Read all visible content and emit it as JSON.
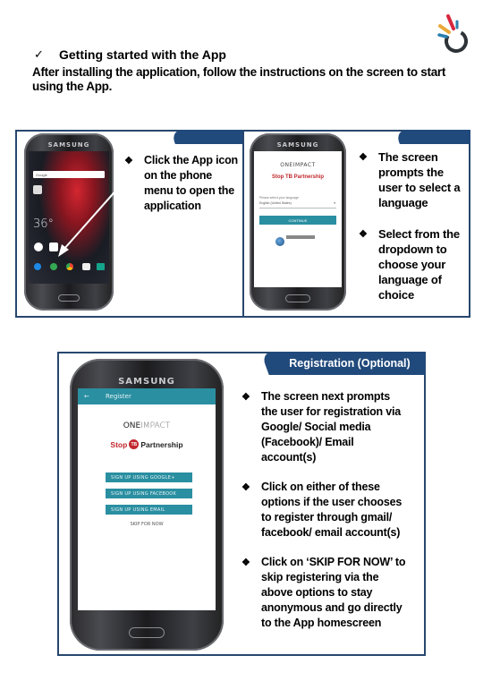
{
  "logo": {
    "icon": "oneimpact-burst-logo",
    "colors": {
      "red": "#d7263d",
      "yellow": "#e9a93a",
      "blue": "#2b7fb0",
      "ring": "#2e3338"
    }
  },
  "heading": {
    "check_icon": "✓",
    "title": "Getting started with the App"
  },
  "intro": "After installing the application, follow the instructions on the screen to start using the App.",
  "frames": {
    "border_color": "#27476e",
    "tab_color": "#214a7c",
    "step1": {
      "bullets": [
        "Click the App icon on the phone menu to open the application"
      ],
      "phone": {
        "brand": "SAMSUNG",
        "search_label": "Google",
        "clock": "36°"
      }
    },
    "step2": {
      "bullets": [
        "The screen prompts the user to select a language",
        "Select from the dropdown to choose your language of choice"
      ],
      "phone": {
        "brand": "SAMSUNG",
        "app_name": "ONEIMPACT",
        "partner": "Stop TB Partnership",
        "select_label": "Please select your language",
        "select_value": "English (United States)",
        "continue_label": "CONTINUE"
      }
    },
    "step3": {
      "tab_label": "Registration (Optional)",
      "bullets": [
        "The screen next prompts the user for registration via Google/ Social media (Facebook)/ Email account(s)",
        "Click on either of these options if the user chooses to register through gmail/ facebook/ email account(s)",
        "Click on ‘SKIP FOR NOW’ to skip registering via the above options to stay anonymous and go directly to the App homescreen"
      ],
      "phone": {
        "brand": "SAMSUNG",
        "header_title": "Register",
        "back_icon": "←",
        "app_name_one": "ONE",
        "app_name_impact": "IMPACT",
        "partner_stop": "Stop",
        "partner_tb": "TB",
        "partner_name": "Partnership",
        "buttons": [
          "SIGN UP USING GOOGLE+",
          "SIGN UP USING FACEBOOK",
          "SIGN UP USING EMAIL"
        ],
        "skip_label": "SKIP FOR NOW",
        "accent": "#2a8fa1"
      }
    }
  },
  "bullet_mark": "❖"
}
